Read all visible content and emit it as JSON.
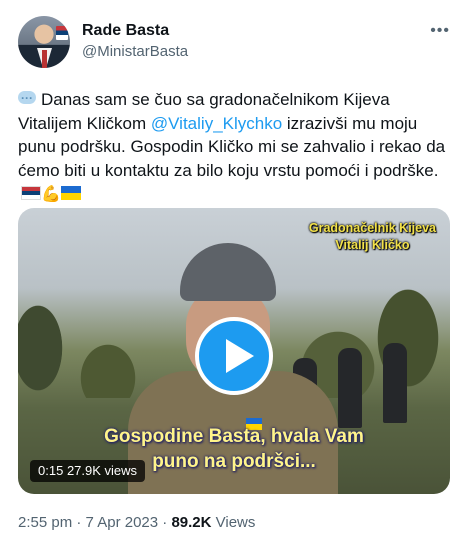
{
  "author": {
    "name": "Rade Basta",
    "handle": "@MinistarBasta"
  },
  "more_icon": "more-horizontal-icon",
  "tweet": {
    "line_1_pre": "Danas sam se čuo sa gradonačelnikom Kijeva Vitalijem Kličkom ",
    "mention": "@Vitaliy_Klychko",
    "line_1_post": " izrazivši mu moju punu podršku. Gospodin Kličko mi se zahvalio i rekao da  ćemo biti u kontaktu za bilo koju vrstu pomoći i podrške.",
    "emojis": [
      "speech-bubble-emoji",
      "serbia-flag-emoji",
      "flexed-biceps-emoji",
      "ukraine-flag-emoji"
    ]
  },
  "video": {
    "caption_top_line1": "Gradonačelnik Kijeva",
    "caption_top_line2": "Vitalij Kličko",
    "subtitle_line1": "Gospodine Basta, hvala Vam",
    "subtitle_line2": "puno na podršci...",
    "duration": "0:15",
    "views_label": "27.9K views",
    "play_icon": "play-icon"
  },
  "meta": {
    "time": "2:55 pm",
    "separator1": " · ",
    "date": "7 Apr 2023",
    "separator2": " · ",
    "views_count": "89.2K",
    "views_label": " Views"
  },
  "colors": {
    "accent": "#1d9bf0",
    "text_primary": "#0f1419",
    "text_secondary": "#536471",
    "caption_yellow": "#f3e24a"
  }
}
